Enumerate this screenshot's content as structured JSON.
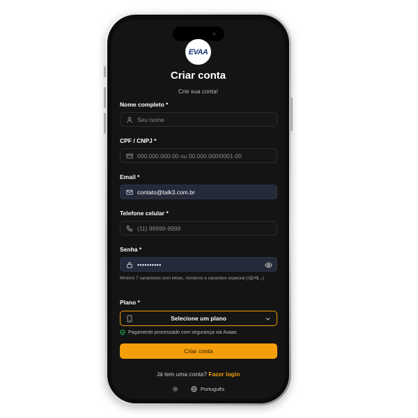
{
  "logo": {
    "text": "EVAA"
  },
  "header": {
    "title": "Criar conta",
    "subtitle": "Crie sua conta!"
  },
  "form": {
    "name": {
      "label": "Nome completo *",
      "placeholder": "Seu nome",
      "icon": "user-icon"
    },
    "document": {
      "label": "CPF / CNPJ *",
      "placeholder": "000.000.000-00 ou 00.000.000/0001-00",
      "icon": "id-card-icon"
    },
    "email": {
      "label": "Email *",
      "value": "contato@talk3.com.br",
      "icon": "mail-icon"
    },
    "phone": {
      "label": "Telefone celular *",
      "placeholder": "(11) 99999-9999",
      "icon": "phone-icon"
    },
    "password": {
      "label": "Senha *",
      "value": "••••••••••",
      "icon": "lock-icon",
      "hint": "Mínimo 7 caracteres com letras, números e caractere especial (!@#$...)"
    },
    "plan": {
      "label": "Plano *",
      "selected": "Selecione um plano",
      "secure_note": "Pagamento processado com segurança via Asaas"
    },
    "submit_label": "Criar conta"
  },
  "login": {
    "prompt": "Já tem uma conta?",
    "link": "Fazer login"
  },
  "footer": {
    "language": "Português"
  },
  "colors": {
    "accent": "#f59e0b",
    "background": "#141414",
    "filled_field": "#252a3a"
  }
}
